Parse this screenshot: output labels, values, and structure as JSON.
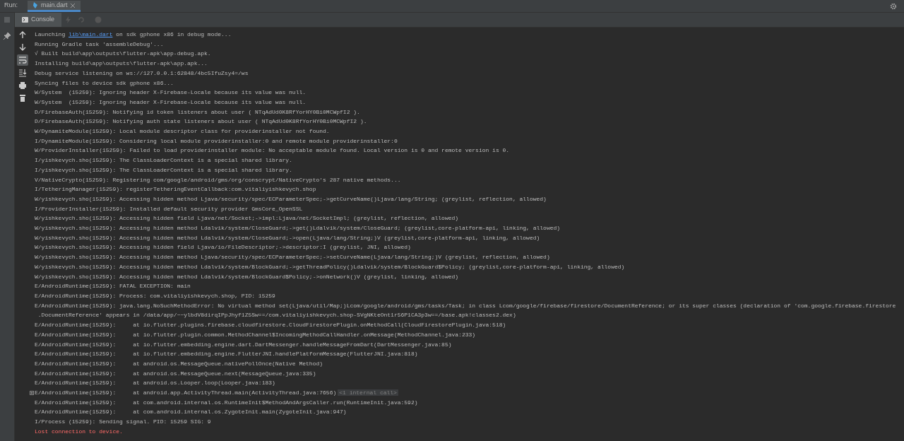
{
  "toolwindow": {
    "label": "Run:",
    "tab": {
      "label": "main.dart",
      "selected": true
    }
  },
  "console_tab": {
    "label": "Console",
    "selected": true
  },
  "side_tools": [
    {
      "kind": "up",
      "selected": false
    },
    {
      "kind": "down",
      "selected": false
    },
    {
      "kind": "wrap",
      "selected": true
    },
    {
      "kind": "scroll-end",
      "selected": false
    },
    {
      "kind": "print",
      "selected": false
    },
    {
      "kind": "trash",
      "selected": false
    }
  ],
  "lines": [
    {
      "kind": "link",
      "text": "Launching ",
      "link": "lib\\main.dart",
      "after": " on sdk gphone x86 in debug mode..."
    },
    {
      "kind": "normal",
      "text": "Running Gradle task 'assembleDebug'..."
    },
    {
      "kind": "normal",
      "text": "√ Built build\\app\\outputs\\flutter-apk\\app-debug.apk."
    },
    {
      "kind": "normal",
      "text": "Installing build\\app\\outputs\\flutter-apk\\app.apk..."
    },
    {
      "kind": "normal",
      "text": "Debug service listening on ws://127.0.0.1:62848/4bc5IfuZsy4=/ws"
    },
    {
      "kind": "normal",
      "text": "Syncing files to device sdk gphone x86..."
    },
    {
      "kind": "normal",
      "text": "W/System  (15259): Ignoring header X-Firebase-Locale because its value was null."
    },
    {
      "kind": "normal",
      "text": "W/System  (15259): Ignoring header X-Firebase-Locale because its value was null."
    },
    {
      "kind": "normal",
      "text": "D/FirebaseAuth(15259): Notifying id token listeners about user ( NTqAdUd0K8RfYorHY0Bi0MCWpfI2 )."
    },
    {
      "kind": "normal",
      "text": "D/FirebaseAuth(15259): Notifying auth state listeners about user ( NTqAdUd0K8RfYorHY0Bi0MCWpfI2 )."
    },
    {
      "kind": "normal",
      "text": "W/DynamiteModule(15259): Local module descriptor class for providerinstaller not found."
    },
    {
      "kind": "normal",
      "text": "I/DynamiteModule(15259): Considering local module providerinstaller:0 and remote module providerinstaller:0"
    },
    {
      "kind": "normal",
      "text": "W/ProviderInstaller(15259): Failed to load providerinstaller module: No acceptable module found. Local version is 0 and remote version is 0."
    },
    {
      "kind": "normal",
      "text": "I/yishkevych.sho(15259): The ClassLoaderContext is a special shared library."
    },
    {
      "kind": "normal",
      "text": "I/yishkevych.sho(15259): The ClassLoaderContext is a special shared library."
    },
    {
      "kind": "normal",
      "text": "V/NativeCrypto(15259): Registering com/google/android/gms/org/conscrypt/NativeCrypto's 287 native methods..."
    },
    {
      "kind": "normal",
      "text": "I/TetheringManager(15259): registerTetheringEventCallback:com.vitaliyishkevych.shop"
    },
    {
      "kind": "normal",
      "text": "W/yishkevych.sho(15259): Accessing hidden method Ljava/security/spec/ECParameterSpec;->getCurveName()Ljava/lang/String; (greylist, reflection, allowed)"
    },
    {
      "kind": "normal",
      "text": "I/ProviderInstaller(15259): Installed default security provider GmsCore_OpenSSL"
    },
    {
      "kind": "normal",
      "text": "W/yishkevych.sho(15259): Accessing hidden field Ljava/net/Socket;->impl:Ljava/net/SocketImpl; (greylist, reflection, allowed)"
    },
    {
      "kind": "normal",
      "text": "W/yishkevych.sho(15259): Accessing hidden method Ldalvik/system/CloseGuard;->get()Ldalvik/system/CloseGuard; (greylist,core-platform-api, linking, allowed)"
    },
    {
      "kind": "normal",
      "text": "W/yishkevych.sho(15259): Accessing hidden method Ldalvik/system/CloseGuard;->open(Ljava/lang/String;)V (greylist,core-platform-api, linking, allowed)"
    },
    {
      "kind": "normal",
      "text": "W/yishkevych.sho(15259): Accessing hidden field Ljava/io/FileDescriptor;->descriptor:I (greylist, JNI, allowed)"
    },
    {
      "kind": "normal",
      "text": "W/yishkevych.sho(15259): Accessing hidden method Ljava/security/spec/ECParameterSpec;->setCurveName(Ljava/lang/String;)V (greylist, reflection, allowed)"
    },
    {
      "kind": "normal",
      "text": "W/yishkevych.sho(15259): Accessing hidden method Ldalvik/system/BlockGuard;->getThreadPolicy()Ldalvik/system/BlockGuard$Policy; (greylist,core-platform-api, linking, allowed)"
    },
    {
      "kind": "normal",
      "text": "W/yishkevych.sho(15259): Accessing hidden method Ldalvik/system/BlockGuard$Policy;->onNetwork()V (greylist, linking, allowed)"
    },
    {
      "kind": "normal",
      "text": "E/AndroidRuntime(15259): FATAL EXCEPTION: main"
    },
    {
      "kind": "normal",
      "text": "E/AndroidRuntime(15259): Process: com.vitaliyishkevych.shop, PID: 15259"
    },
    {
      "kind": "normal",
      "text": "E/AndroidRuntime(15259): java.lang.NoSuchMethodError: No virtual method set(Ljava/util/Map;)Lcom/google/android/gms/tasks/Task; in class Lcom/google/firebase/firestore/DocumentReference; or its super classes (declaration of 'com.google.firebase.firestore"
    },
    {
      "kind": "normal",
      "text": " .DocumentReference' appears in /data/app/~~ylbdV8dirqIPpJhyf1Z5Sw==/com.vitaliyishkevych.shop-SVgNKteOnt1r56P1CA3p3w==/base.apk!classes2.dex)"
    },
    {
      "kind": "normal",
      "text": "E/AndroidRuntime(15259):     at io.flutter.plugins.firebase.cloudfirestore.CloudFirestorePlugin.onMethodCall(CloudFirestorePlugin.java:518)"
    },
    {
      "kind": "normal",
      "text": "E/AndroidRuntime(15259):     at io.flutter.plugin.common.MethodChannel$IncomingMethodCallHandler.onMessage(MethodChannel.java:233)"
    },
    {
      "kind": "normal",
      "text": "E/AndroidRuntime(15259):     at io.flutter.embedding.engine.dart.DartMessenger.handleMessageFromDart(DartMessenger.java:85)"
    },
    {
      "kind": "normal",
      "text": "E/AndroidRuntime(15259):     at io.flutter.embedding.engine.FlutterJNI.handlePlatformMessage(FlutterJNI.java:818)"
    },
    {
      "kind": "normal",
      "text": "E/AndroidRuntime(15259):     at android.os.MessageQueue.nativePollOnce(Native Method)"
    },
    {
      "kind": "normal",
      "text": "E/AndroidRuntime(15259):     at android.os.MessageQueue.next(MessageQueue.java:335)"
    },
    {
      "kind": "normal",
      "text": "E/AndroidRuntime(15259):     at android.os.Looper.loop(Looper.java:183)"
    },
    {
      "kind": "folded",
      "text": "E/AndroidRuntime(15259):     at android.app.ActivityThread.main(ActivityThread.java:7656)",
      "note": "<1 internal call>",
      "expanded": false
    },
    {
      "kind": "normal",
      "text": "E/AndroidRuntime(15259):     at com.android.internal.os.RuntimeInit$MethodAndArgsCaller.run(RuntimeInit.java:592)"
    },
    {
      "kind": "normal",
      "text": "E/AndroidRuntime(15259):     at com.android.internal.os.ZygoteInit.main(ZygoteInit.java:947)"
    },
    {
      "kind": "normal",
      "text": "I/Process (15259): Sending signal. PID: 15259 SIG: 9"
    },
    {
      "kind": "error",
      "text": "Lost connection to device."
    }
  ]
}
